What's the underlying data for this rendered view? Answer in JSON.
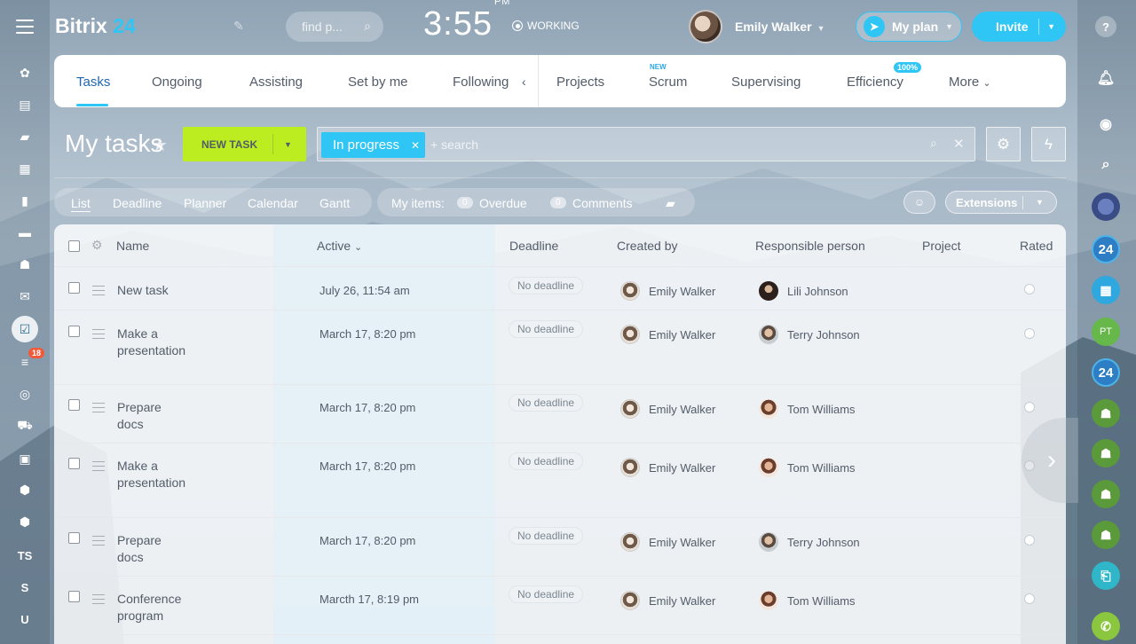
{
  "header": {
    "logo_text": "Bitrix",
    "logo_num": "24",
    "search_placeholder": "find p...",
    "time": "3:55",
    "ampm": "PM",
    "status": "WORKING",
    "user_name": "Emily Walker",
    "myplan_label": "My plan",
    "invite_label": "Invite"
  },
  "left_sidebar": {
    "badge_count": "18",
    "text_items": [
      "TS",
      "S",
      "U"
    ]
  },
  "tabs": [
    {
      "label": "Tasks",
      "active": true
    },
    {
      "label": "Ongoing"
    },
    {
      "label": "Assisting"
    },
    {
      "label": "Set by me"
    },
    {
      "label": "Following"
    },
    {
      "label": "Projects"
    },
    {
      "label": "Scrum",
      "badge": "NEW"
    },
    {
      "label": "Supervising"
    },
    {
      "label": "Efficiency",
      "badge": "100%"
    },
    {
      "label": "More"
    }
  ],
  "toolbar": {
    "page_title": "My tasks",
    "new_task_label": "NEW TASK",
    "filter_chip": "In progress",
    "filter_search_placeholder": "+ search"
  },
  "views": {
    "items": [
      "List",
      "Deadline",
      "Planner",
      "Calendar",
      "Gantt"
    ],
    "active": "List"
  },
  "counters": {
    "label": "My items:",
    "overdue_count": "0",
    "overdue_label": "Overdue",
    "comments_count": "0",
    "comments_label": "Comments"
  },
  "extensions_label": "Extensions",
  "table": {
    "columns": [
      "Name",
      "Active",
      "Deadline",
      "Created by",
      "Responsible person",
      "Project",
      "Rated"
    ],
    "rows": [
      {
        "name": "New task",
        "active": "July 26, 11:54 am",
        "deadline": "No deadline",
        "created_by": "Emily Walker",
        "responsible": "Lili Johnson"
      },
      {
        "name": "Make a presentation",
        "active": "March 17, 8:20 pm",
        "deadline": "No deadline",
        "created_by": "Emily Walker",
        "responsible": "Terry Johnson"
      },
      {
        "name": "Prepare docs",
        "active": "March 17, 8:20 pm",
        "deadline": "No deadline",
        "created_by": "Emily Walker",
        "responsible": "Tom Williams"
      },
      {
        "name": "Make a presentation",
        "active": "March 17, 8:20 pm",
        "deadline": "No deadline",
        "created_by": "Emily Walker",
        "responsible": "Tom Williams"
      },
      {
        "name": "Prepare docs",
        "active": "March 17, 8:20 pm",
        "deadline": "No deadline",
        "created_by": "Emily Walker",
        "responsible": "Terry Johnson"
      },
      {
        "name": "Conference program",
        "active": "Marcth 17, 8:19 pm",
        "deadline": "No deadline",
        "created_by": "Emily Walker",
        "responsible": "Tom Williams"
      }
    ]
  },
  "right_sidebar": {
    "pt_initials": "PT",
    "b24_label": "24"
  }
}
